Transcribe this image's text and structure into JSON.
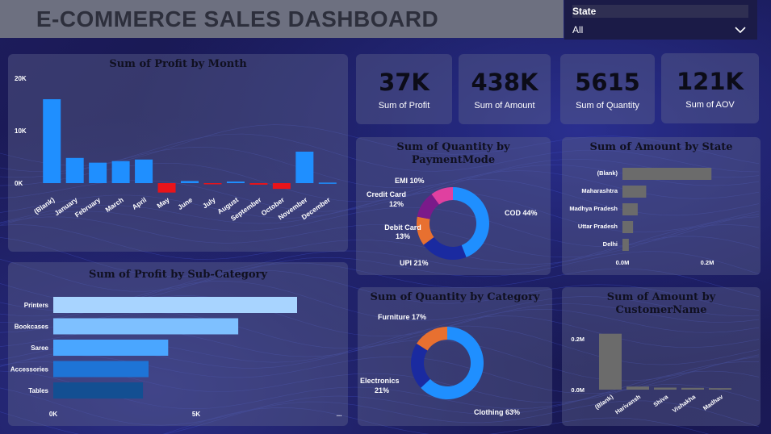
{
  "title": "E-COMMERCE SALES DASHBOARD",
  "slicer": {
    "label": "State",
    "value": "All"
  },
  "kpis": [
    {
      "value": "37K",
      "label": "Sum of Profit"
    },
    {
      "value": "438K",
      "label": "Sum of Amount"
    },
    {
      "value": "5615",
      "label": "Sum of Quantity"
    },
    {
      "value": "121K",
      "label": "Sum of AOV"
    }
  ],
  "colors": {
    "blue": "#1f8fff",
    "red": "#e8141a",
    "gray": "#6b6b6b",
    "pink": "#e040a0",
    "purple": "#7a1a8a",
    "orange": "#e87030",
    "navy": "#1a2aa0",
    "lightblue": "#2f8ff0"
  },
  "chart_data": [
    {
      "type": "bar",
      "title": "Sum of Profit by Month",
      "categories": [
        "(Blank)",
        "January",
        "February",
        "March",
        "April",
        "May",
        "June",
        "July",
        "August",
        "September",
        "October",
        "November",
        "December"
      ],
      "values": [
        16000,
        4800,
        3900,
        4200,
        4500,
        -1800,
        400,
        -200,
        300,
        -300,
        -1100,
        6000,
        100
      ],
      "ticks": [
        "20K",
        "10K",
        "0K"
      ],
      "ylim": [
        -3000,
        20000
      ]
    },
    {
      "type": "bar",
      "orientation": "horizontal",
      "title": "Sum of Profit by Sub-Category",
      "categories": [
        "Printers",
        "Bookcases",
        "Saree",
        "Accessories",
        "Tables"
      ],
      "values": [
        8700,
        6600,
        4100,
        3400,
        3200
      ],
      "ticks": [
        "0K",
        "5K",
        "..."
      ],
      "colors": [
        "#a8d4ff",
        "#7ec0ff",
        "#4aa6ff",
        "#1e74d6",
        "#134f92"
      ]
    },
    {
      "type": "pie",
      "title": "Sum of Quantity by PaymentMode",
      "slices": [
        {
          "label": "COD",
          "pct": 44,
          "text": "COD 44%",
          "color": "#1f8fff"
        },
        {
          "label": "UPI",
          "pct": 21,
          "text": "UPI 21%",
          "color": "#1a2aa0"
        },
        {
          "label": "Debit Card",
          "pct": 13,
          "text1": "Debit Card",
          "text2": "13%",
          "color": "#e87030"
        },
        {
          "label": "Credit Card",
          "pct": 12,
          "text1": "Credit Card",
          "text2": "12%",
          "color": "#7a1a8a"
        },
        {
          "label": "EMI",
          "pct": 10,
          "text": "EMI 10%",
          "color": "#e040a0"
        }
      ]
    },
    {
      "type": "bar",
      "orientation": "horizontal",
      "title": "Sum of Amount by State",
      "categories": [
        "(Blank)",
        "Maharashtra",
        "Madhya Pradesh",
        "Uttar Pradesh",
        "Delhi"
      ],
      "values": [
        0.21,
        0.056,
        0.036,
        0.025,
        0.015
      ],
      "ticks": [
        "0.0M",
        "0.2M"
      ],
      "xlim": [
        0,
        0.2
      ]
    },
    {
      "type": "pie",
      "title": "Sum of Quantity by Category",
      "slices": [
        {
          "label": "Clothing",
          "pct": 63,
          "text": "Clothing 63%",
          "color": "#1f8fff"
        },
        {
          "label": "Electronics",
          "pct": 21,
          "text1": "Electronics",
          "text2": "21%",
          "color": "#1a2aa0"
        },
        {
          "label": "Furniture",
          "pct": 16,
          "text": "Furniture 17%",
          "color": "#e87030"
        }
      ]
    },
    {
      "type": "bar",
      "title": "Sum of Amount by CustomerName",
      "categories": [
        "(Blank)",
        "Harivansh",
        "Shiva",
        "Vishakha",
        "Madhav"
      ],
      "values": [
        0.22,
        0.012,
        0.008,
        0.007,
        0.006
      ],
      "ticks": [
        "0.2M",
        "0.0M"
      ],
      "ylim": [
        0,
        0.2
      ]
    }
  ]
}
